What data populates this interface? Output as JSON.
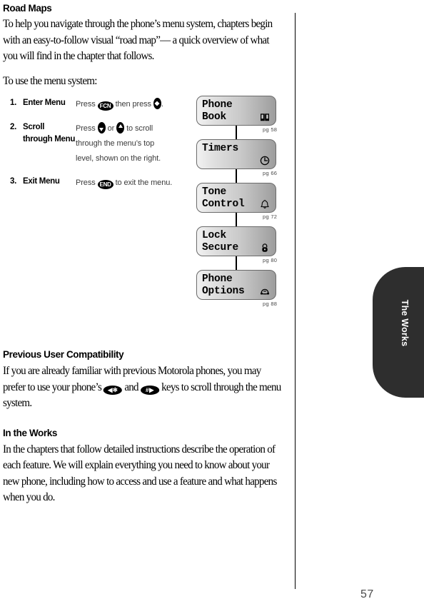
{
  "page": {
    "folio": "57",
    "side_tab_label": "The Works"
  },
  "sections": {
    "road_maps": {
      "heading": "Road Maps",
      "para1": "To help you navigate through the phone’s menu system, chapters begin with an easy-to-follow visual “road map”— a quick overview of what you will find in the chapter that follows.",
      "para2": "To use the menu system:"
    },
    "previous_user": {
      "heading": "Previous User Compatibility",
      "para_before_keys": "If you are already familiar with previous Motorola phones, you may prefer to use your phone’s",
      "key_star": "◀✻",
      "conjunction": "and",
      "key_hash": "#▶",
      "para_after_keys": "keys to scroll through the menu system."
    },
    "in_the_works": {
      "heading": "In the Works",
      "para1": "In the chapters that follow detailed instructions describe the operation of each feature. We will explain everything you need to know about your new phone, including how to access and use a feature and what happens when you do."
    }
  },
  "steps": [
    {
      "number": "1.",
      "title": "Enter Menu",
      "text_before_key": "Press",
      "key": "FCN",
      "text_mid": "then press",
      "text_after": "."
    },
    {
      "number": "2.",
      "title": "Scroll through Menu",
      "text_before_key": "Press",
      "text_mid": "or",
      "text_after": "to scroll through the menu’s top level, shown on the right."
    },
    {
      "number": "3.",
      "title": "Exit Menu",
      "text_before_key": "Press",
      "key": "END",
      "text_after": "to exit the menu."
    }
  ],
  "roadmap": {
    "nodes": [
      {
        "label": "Phone\nBook",
        "page_ref": "pg 58",
        "icon": "book-icon"
      },
      {
        "label": "Timers",
        "page_ref": "pg 66",
        "icon": "clock-icon"
      },
      {
        "label": "Tone\nControl",
        "page_ref": "pg 72",
        "icon": "bell-icon"
      },
      {
        "label": "Lock\nSecure",
        "page_ref": "pg 80",
        "icon": "lock-icon"
      },
      {
        "label": "Phone\nOptions",
        "page_ref": "pg 88",
        "icon": "telephone-icon"
      }
    ]
  }
}
